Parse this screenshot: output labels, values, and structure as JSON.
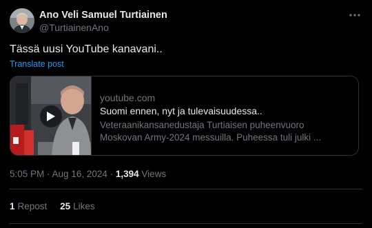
{
  "author": {
    "name": "Ano Veli Samuel Turtiainen",
    "handle": "@TurtiainenAno",
    "avatar_icon": "user-avatar"
  },
  "post": {
    "text": "Tässä uusi YouTube kanavani..",
    "translate_label": "Translate post"
  },
  "card": {
    "domain": "youtube.com",
    "title": "Suomi ennen, nyt ja tulevaisuudessa..",
    "description_line1": "Veteraanikansanedustaja Turtiaisen puheenvuoro",
    "description_line2": "Moskovan Army-2024 messuilla. Puheessa tuli julki ...",
    "play_icon": "play-icon"
  },
  "meta": {
    "time": "5:05 PM",
    "separator": " · ",
    "date": "Aug 16, 2024",
    "views_count": "1,394",
    "views_label": " Views"
  },
  "stats": {
    "reposts_count": "1",
    "reposts_label": "Repost",
    "likes_count": "25",
    "likes_label": "Likes"
  },
  "colors": {
    "background": "#000000",
    "text_primary": "#e7e9ea",
    "text_secondary": "#71767b",
    "link": "#1d9bf0",
    "border": "#2f3336"
  }
}
